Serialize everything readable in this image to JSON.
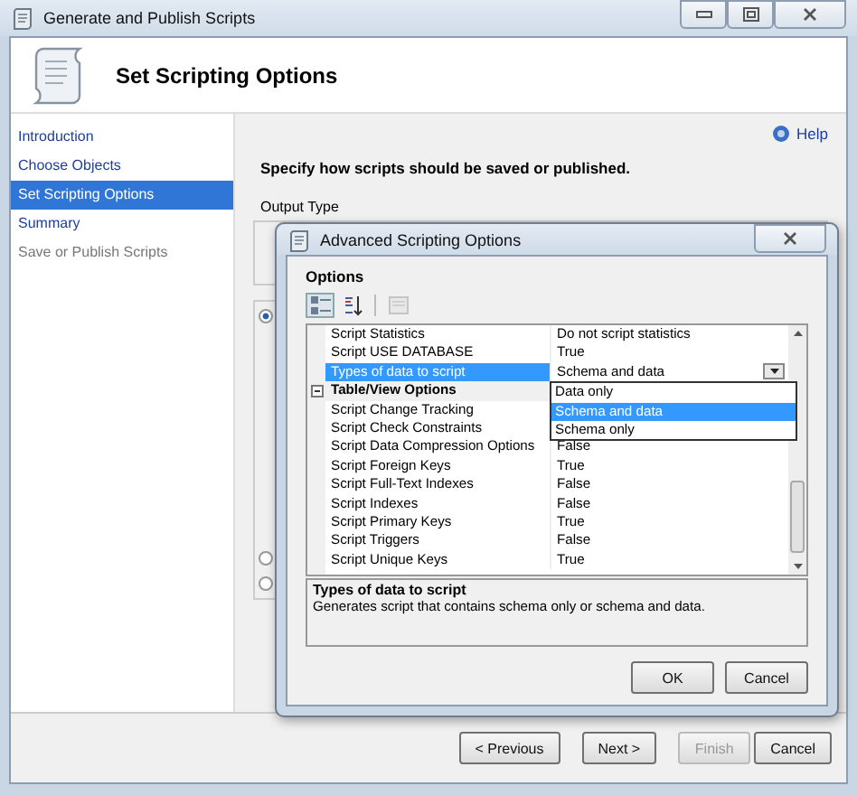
{
  "window": {
    "title": "Generate and Publish Scripts"
  },
  "header": {
    "title": "Set Scripting Options"
  },
  "sidebar": {
    "items": [
      {
        "label": "Introduction",
        "selected": false,
        "disabled": false
      },
      {
        "label": "Choose Objects",
        "selected": false,
        "disabled": false
      },
      {
        "label": "Set Scripting Options",
        "selected": true,
        "disabled": false
      },
      {
        "label": "Summary",
        "selected": false,
        "disabled": false
      },
      {
        "label": "Save or Publish Scripts",
        "selected": false,
        "disabled": true
      }
    ]
  },
  "help": {
    "label": "Help"
  },
  "instruction": "Specify how scripts should be saved or published.",
  "output_type": {
    "label": "Output Type",
    "radios": [
      {
        "selected": true
      },
      {
        "selected": false
      },
      {
        "selected": false
      }
    ]
  },
  "dialog": {
    "title": "Advanced Scripting Options",
    "options_label": "Options",
    "toolbar": [
      {
        "kind": "categorized",
        "selected": true,
        "disabled": false
      },
      {
        "kind": "alphabetical",
        "selected": false,
        "disabled": false
      },
      {
        "kind": "pages",
        "selected": false,
        "disabled": true
      }
    ],
    "rows": [
      {
        "kind": "property",
        "name": "Script Statistics",
        "value": "Do not script statistics",
        "selected": false
      },
      {
        "kind": "property",
        "name": "Script USE DATABASE",
        "value": "True",
        "selected": false
      },
      {
        "kind": "property",
        "name": "Types of data to script",
        "value": "Schema and data",
        "selected": true
      },
      {
        "kind": "category",
        "name": "Table/View Options",
        "expanded": true
      },
      {
        "kind": "property",
        "name": "Script Change Tracking",
        "selected": false
      },
      {
        "kind": "property",
        "name": "Script Check Constraints",
        "selected": false
      },
      {
        "kind": "property",
        "name": "Script Data Compression Options",
        "value": "False",
        "selected": false
      },
      {
        "kind": "property",
        "name": "Script Foreign Keys",
        "value": "True",
        "selected": false
      },
      {
        "kind": "property",
        "name": "Script Full-Text Indexes",
        "value": "False",
        "selected": false
      },
      {
        "kind": "property",
        "name": "Script Indexes",
        "value": "False",
        "selected": false
      },
      {
        "kind": "property",
        "name": "Script Primary Keys",
        "value": "True",
        "selected": false
      },
      {
        "kind": "property",
        "name": "Script Triggers",
        "value": "False",
        "selected": false
      },
      {
        "kind": "property",
        "name": "Script Unique Keys",
        "value": "True",
        "selected": false
      }
    ],
    "dropdown": [
      {
        "label": "Data only",
        "selected": false
      },
      {
        "label": "Schema and data",
        "selected": true
      },
      {
        "label": "Schema only",
        "selected": false
      }
    ],
    "description": {
      "title": "Types of data to script",
      "text": "Generates script that contains schema only or schema and data."
    },
    "buttons": [
      "OK",
      "Cancel"
    ]
  },
  "footer_buttons": [
    {
      "label": "< Previous",
      "disabled": false
    },
    {
      "label": "Next >",
      "disabled": false
    },
    {
      "label": "Finish",
      "disabled": true
    },
    {
      "label": "Cancel",
      "disabled": false
    }
  ]
}
